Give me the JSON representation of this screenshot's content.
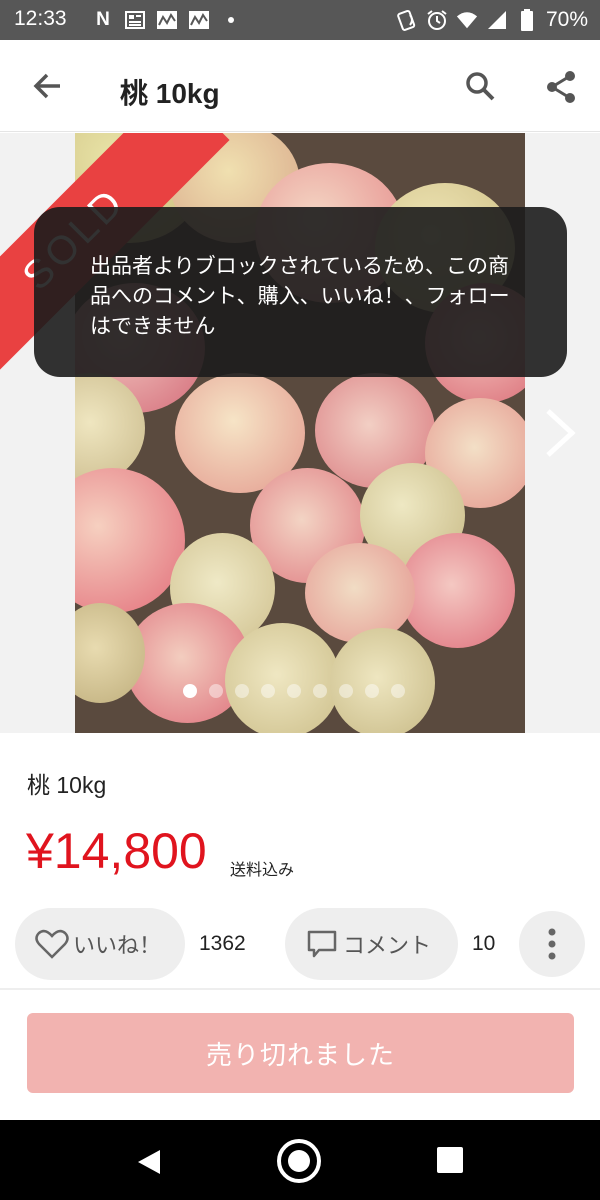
{
  "status_bar": {
    "time": "12:33",
    "left_icons": [
      "netflix-n-icon",
      "news-icon",
      "stock-chart-icon",
      "stock-chart-icon",
      "dot-icon"
    ],
    "battery_text": "70%",
    "right_icons": [
      "nfc-icon",
      "alarm-icon",
      "wifi-icon",
      "signal-icon",
      "battery-icon"
    ]
  },
  "app_bar": {
    "title": "桃 10kg",
    "icons": [
      "back-arrow-icon",
      "search-icon",
      "share-icon"
    ]
  },
  "photo": {
    "badge": "SOLD",
    "page_count": 9,
    "active_page": 1
  },
  "toast": {
    "message": "出品者よりブロックされているため、この商品へのコメント、購入、いいね！、フォローはできません"
  },
  "item": {
    "name": "桃 10kg",
    "price": "¥14,800",
    "shipping": "送料込み"
  },
  "actions": {
    "like_label": "いいね！",
    "like_count": "1362",
    "comment_label": "コメント",
    "comment_count": "10"
  },
  "purchase": {
    "label": "売り切れました"
  },
  "colors": {
    "price": "#e0141e",
    "sold_badge": "#e94141",
    "buy_button_disabled": "#f2b3b0"
  }
}
